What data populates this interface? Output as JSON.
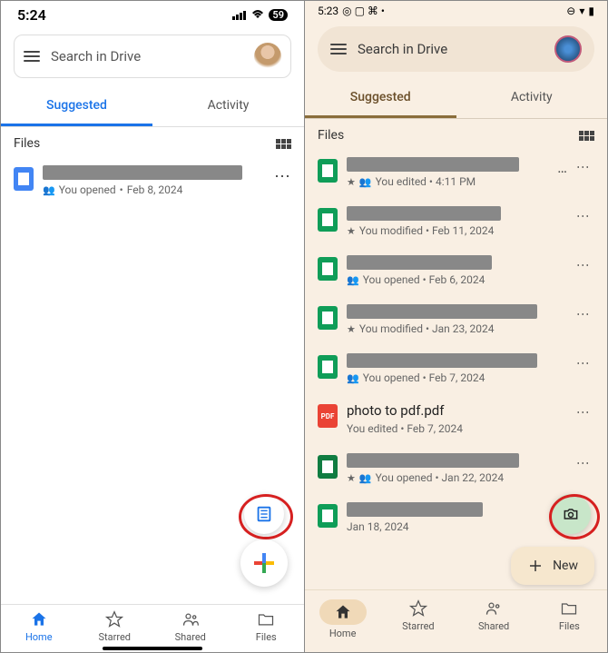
{
  "left": {
    "status": {
      "time": "5:24",
      "battery": "59"
    },
    "search_placeholder": "Search in Drive",
    "tabs": {
      "suggested": "Suggested",
      "activity": "Activity"
    },
    "section_label": "Files",
    "file1": {
      "meta_prefix": "You opened",
      "meta_date": "Feb 8, 2024"
    },
    "nav": {
      "home": "Home",
      "starred": "Starred",
      "shared": "Shared",
      "files": "Files"
    }
  },
  "right": {
    "status": {
      "time": "5:23"
    },
    "search_placeholder": "Search in Drive",
    "tabs": {
      "suggested": "Suggested",
      "activity": "Activity"
    },
    "section_label": "Files",
    "files": [
      {
        "meta": "You edited • 4:11 PM",
        "starred": true,
        "shared": true
      },
      {
        "meta": "You modified • Feb 11, 2024",
        "starred": true
      },
      {
        "meta": "You opened • Feb 6, 2024",
        "shared": true
      },
      {
        "meta": "You modified • Jan 23, 2024",
        "starred": true
      },
      {
        "meta": "You opened • Feb 7, 2024",
        "shared": true
      },
      {
        "title": "photo to pdf.pdf",
        "meta": "You edited • Feb 7, 2024"
      },
      {
        "meta": "You opened • Jan 22, 2024",
        "starred": true,
        "shared": true
      },
      {
        "meta": "Jan 18, 2024"
      }
    ],
    "new_label": "New",
    "nav": {
      "home": "Home",
      "starred": "Starred",
      "shared": "Shared",
      "files": "Files"
    }
  }
}
